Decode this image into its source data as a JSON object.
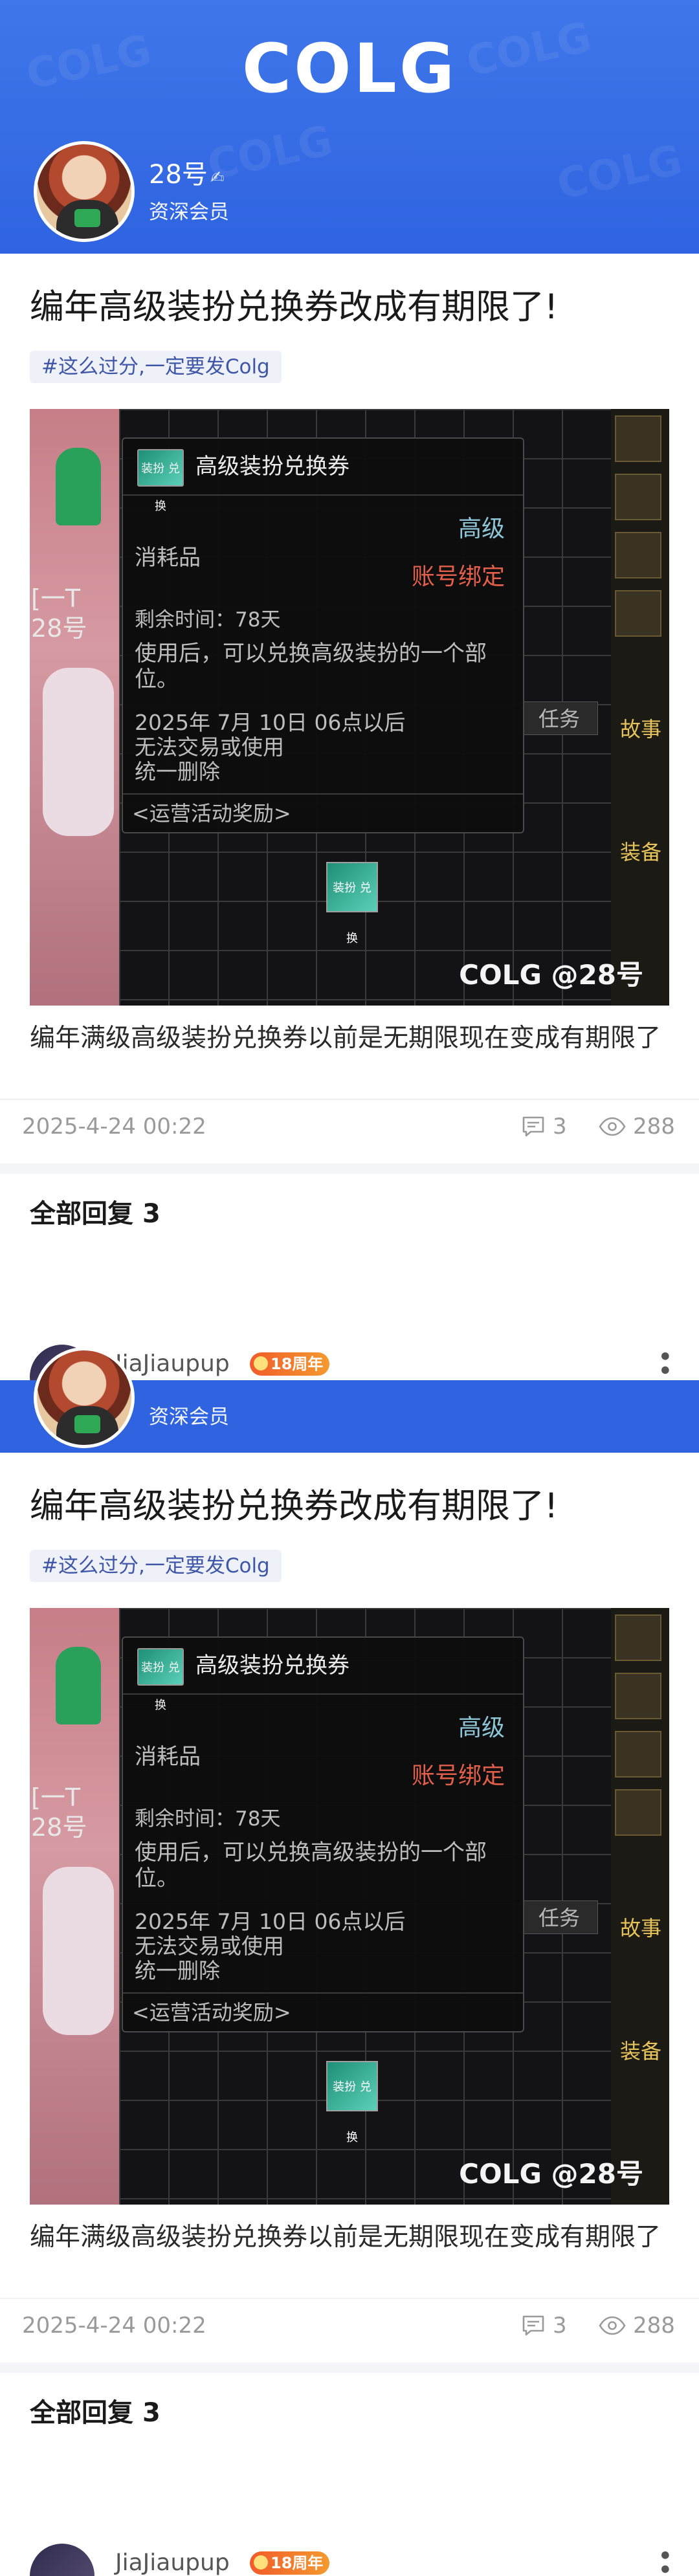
{
  "header": {
    "logo_text": "COLG",
    "brand_color": "#2f63e0"
  },
  "author": {
    "name": "28号",
    "rank": "资深会员"
  },
  "post": {
    "title": "编年高级装扮兑换券改成有期限了!",
    "tag": "#这么过分,一定要发Colg",
    "body": "编年满级高级装扮兑换券以前是无期限现在变成有期限了",
    "date": "2025-4-24 00:22",
    "comment_count": "3",
    "view_count": "288",
    "replies_label": "全部回复",
    "replies_count": "3"
  },
  "screenshot": {
    "item_name": "高级装扮兑换券",
    "grade": "高级",
    "kind": "消耗品",
    "bind": "账号绑定",
    "remain": "剩余时间：78天",
    "desc": "使用后，可以兑换高级装扮的一个部位。",
    "expire_line1": "2025年 7月 10日 06点以后",
    "expire_line2": "无法交易或使用",
    "expire_line3": "统一删除",
    "source": "<运营活动奖励>",
    "task_label": "任务",
    "left_text": "[一T 28号",
    "watermark": "COLG @28号",
    "icon_text": "装扮 兑换"
  },
  "comment": {
    "name": "JiaJiaupup",
    "badge": "18周年"
  }
}
